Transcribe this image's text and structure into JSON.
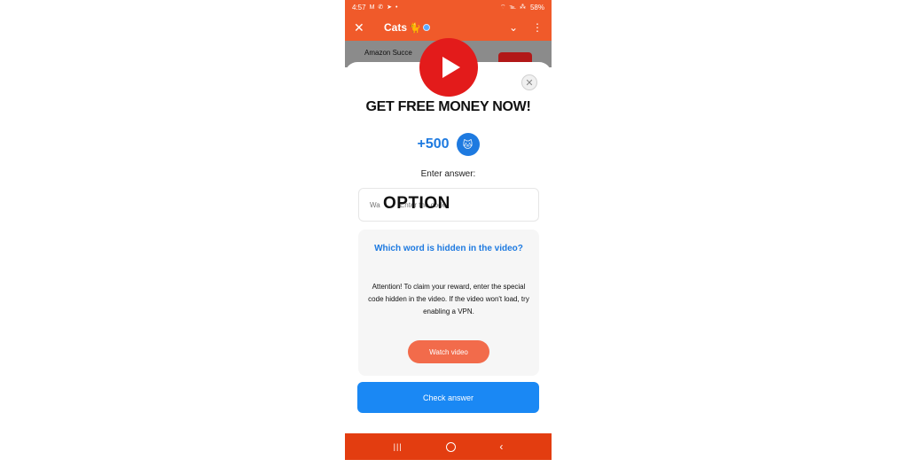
{
  "status_bar": {
    "time": "4:57",
    "left_icons": "M ✆ ➤ •",
    "right_icons": "⌔ ℡ ⁂",
    "battery": "58%"
  },
  "header": {
    "title": "Cats",
    "title_emoji": "🐈",
    "chevron": "⌄",
    "more": "⋮",
    "close": "✕"
  },
  "chat_preview": {
    "text": "Amazon Succe"
  },
  "modal": {
    "close": "✕",
    "headline": "GET FREE MONEY NOW!",
    "reward_amount": "+500",
    "reward_icon": "🐱",
    "answer_label": "Enter answer:",
    "answer_placeholder": "Wa          Enter the code",
    "overlay_text": "OPTION",
    "question": "Which word is hidden in the video?",
    "instructions": "Attention! To claim your reward, enter the special code hidden in the video. If the video won't load, try enabling a VPN.",
    "watch_button": "Watch video",
    "check_button": "Check answer"
  },
  "nav": {
    "recents": "|||",
    "back": "‹"
  },
  "colors": {
    "brand": "#f05a2a",
    "primary": "#1a88f4",
    "accent_orange": "#f26b4b",
    "youtube_red": "#e31b1b"
  }
}
